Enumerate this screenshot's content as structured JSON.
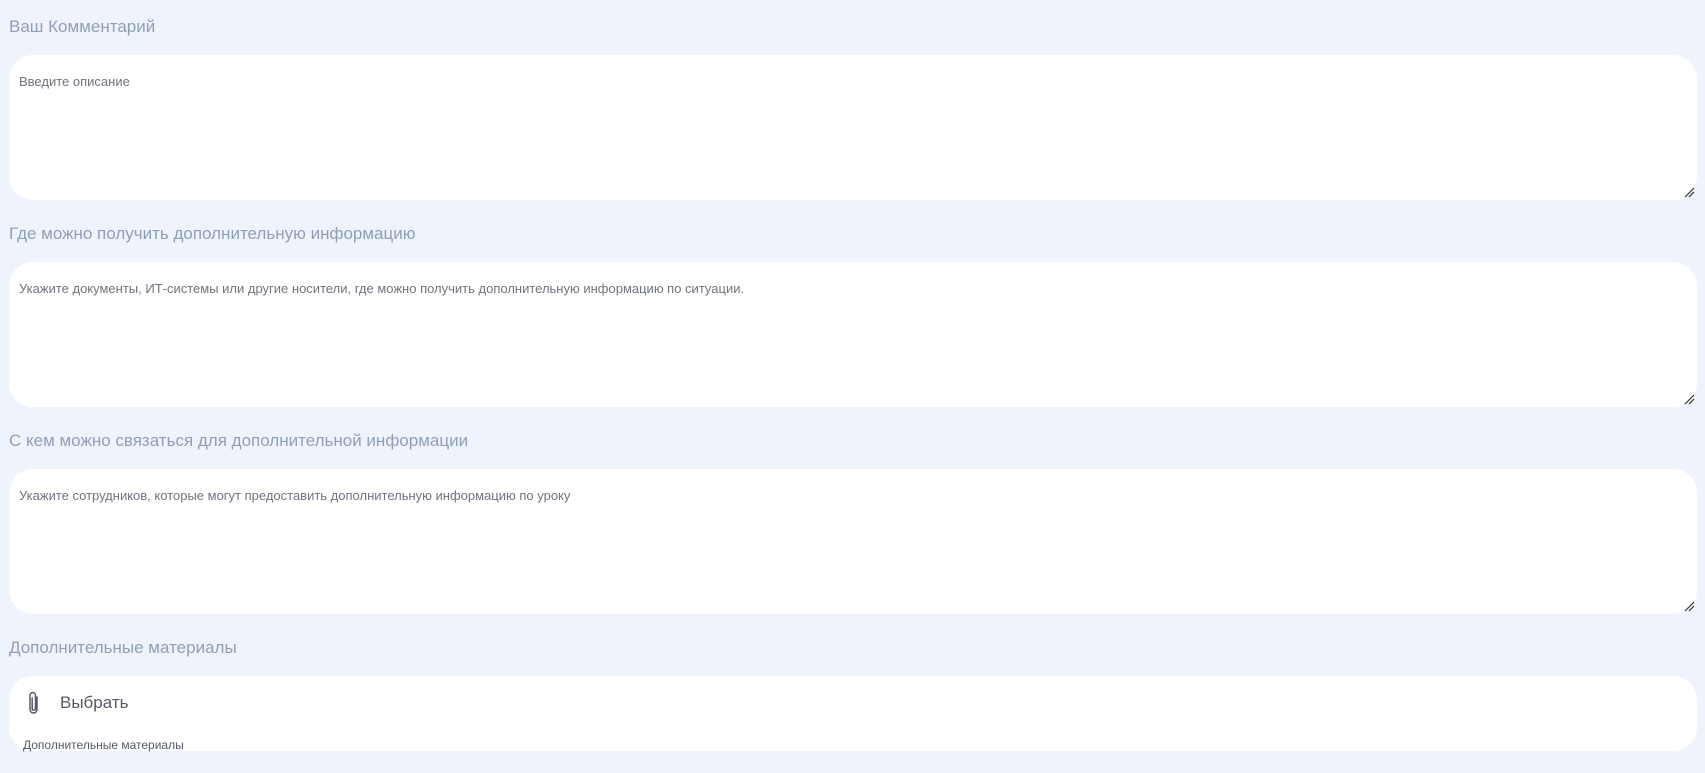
{
  "comment": {
    "label": "Ваш Комментарий",
    "placeholder": "Введите описание"
  },
  "more_info_location": {
    "label": "Где можно получить дополнительную информацию",
    "placeholder": "Укажите документы, ИТ-системы или другие носители, где можно получить дополнительную информацию по ситуации."
  },
  "more_info_contact": {
    "label": "С кем можно связаться для дополнительной информации",
    "placeholder": "Укажите сотрудников, которые могут предоставить дополнительную информацию по уроку"
  },
  "attachments": {
    "label": "Дополнительные материалы",
    "choose_label": "Выбрать",
    "hint": "Дополнительные материалы",
    "icon": "paperclip-icon"
  },
  "colors": {
    "background": "#eff4fc",
    "label": "#8f9fb8",
    "field": "#ffffff"
  }
}
